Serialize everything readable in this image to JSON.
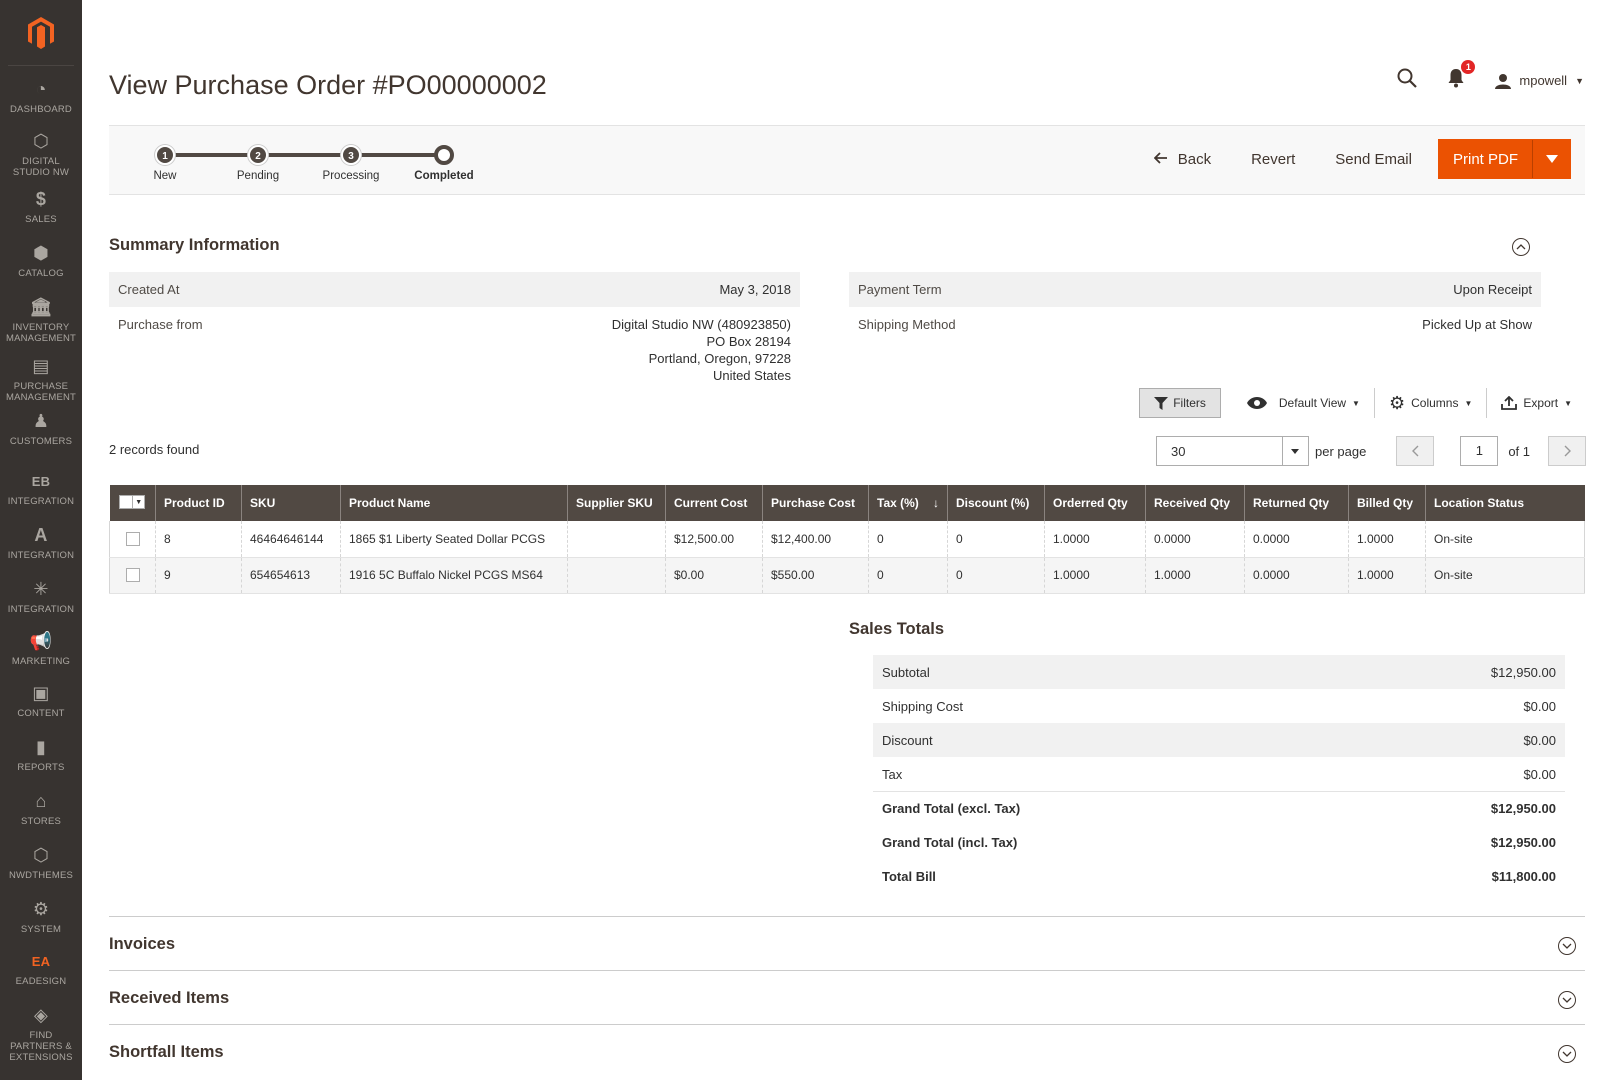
{
  "sidebar": {
    "items": [
      {
        "label": "DASHBOARD",
        "icon": "dashboard-icon"
      },
      {
        "label": "DIGITAL STUDIO NW",
        "icon": "hexagon-icon"
      },
      {
        "label": "SALES",
        "icon": "dollar-icon"
      },
      {
        "label": "CATALOG",
        "icon": "box-icon"
      },
      {
        "label": "INVENTORY MANAGEMENT",
        "icon": "bank-icon"
      },
      {
        "label": "PURCHASE MANAGEMENT",
        "icon": "document-icon"
      },
      {
        "label": "CUSTOMERS",
        "icon": "person-icon"
      },
      {
        "label": "INTEGRATION",
        "icon": "ebay-icon"
      },
      {
        "label": "INTEGRATION",
        "icon": "amazon-icon"
      },
      {
        "label": "INTEGRATION",
        "icon": "walmart-spark-icon"
      },
      {
        "label": "MARKETING",
        "icon": "megaphone-icon"
      },
      {
        "label": "CONTENT",
        "icon": "layout-icon"
      },
      {
        "label": "REPORTS",
        "icon": "bar-chart-icon"
      },
      {
        "label": "STORES",
        "icon": "store-icon"
      },
      {
        "label": "NWDTHEMES",
        "icon": "hexagon-icon"
      },
      {
        "label": "SYSTEM",
        "icon": "gear-icon"
      },
      {
        "label": "EADESIGN",
        "icon": "eadesign-logo-icon"
      },
      {
        "label": "FIND PARTNERS & EXTENSIONS",
        "icon": "cube-icon"
      }
    ]
  },
  "header": {
    "title": "View Purchase Order #PO00000002",
    "notification_count": "1",
    "username": "mpowell"
  },
  "status": {
    "steps": [
      {
        "num": "1",
        "label": "New"
      },
      {
        "num": "2",
        "label": "Pending"
      },
      {
        "num": "3",
        "label": "Processing"
      },
      {
        "num": "",
        "label": "Completed"
      }
    ]
  },
  "actions": {
    "back": "Back",
    "revert": "Revert",
    "send_email": "Send Email",
    "print_pdf": "Print PDF"
  },
  "summary": {
    "title": "Summary Information",
    "created_at_label": "Created At",
    "created_at": "May 3, 2018",
    "purchase_from_label": "Purchase from",
    "purchase_from": [
      "Digital Studio NW (480923850)",
      "PO Box 28194",
      "Portland, Oregon, 97228",
      "United States"
    ],
    "payment_term_label": "Payment Term",
    "payment_term": "Upon Receipt",
    "shipping_method_label": "Shipping Method",
    "shipping_method": "Picked Up at Show"
  },
  "grid": {
    "filters": "Filters",
    "view": "Default View",
    "columns": "Columns",
    "export": "Export",
    "records": "2 records found",
    "per_page_value": "30",
    "per_page_label": "per page",
    "page": "1",
    "of_pages": "of 1",
    "headers": [
      "Product ID",
      "SKU",
      "Product Name",
      "Supplier SKU",
      "Current Cost",
      "Purchase Cost",
      "Tax (%)",
      "Discount (%)",
      "Orderred Qty",
      "Received Qty",
      "Returned Qty",
      "Billed Qty",
      "Location Status"
    ],
    "rows": [
      [
        "8",
        "46464646144",
        "1865 $1 Liberty Seated Dollar PCGS",
        "",
        "$12,500.00",
        "$12,400.00",
        "0",
        "0",
        "1.0000",
        "0.0000",
        "0.0000",
        "1.0000",
        "On-site"
      ],
      [
        "9",
        "654654613",
        "1916 5C Buffalo Nickel PCGS MS64",
        "",
        "$0.00",
        "$550.00",
        "0",
        "0",
        "1.0000",
        "1.0000",
        "0.0000",
        "1.0000",
        "On-site"
      ]
    ]
  },
  "totals": {
    "title": "Sales Totals",
    "rows": [
      {
        "label": "Subtotal",
        "value": "$12,950.00"
      },
      {
        "label": "Shipping Cost",
        "value": "$0.00"
      },
      {
        "label": "Discount",
        "value": "$0.00"
      },
      {
        "label": "Tax",
        "value": "$0.00"
      },
      {
        "label": "Grand Total (excl. Tax)",
        "value": "$12,950.00"
      },
      {
        "label": "Grand Total (incl. Tax)",
        "value": "$12,950.00"
      },
      {
        "label": "Total Bill",
        "value": "$11,800.00"
      }
    ]
  },
  "sections": {
    "invoices": "Invoices",
    "received_items": "Received Items",
    "shortfall_items": "Shortfall Items"
  },
  "colors": {
    "sidebar_bg": "#373330",
    "accent": "#eb5202",
    "grid_header": "#514943"
  }
}
